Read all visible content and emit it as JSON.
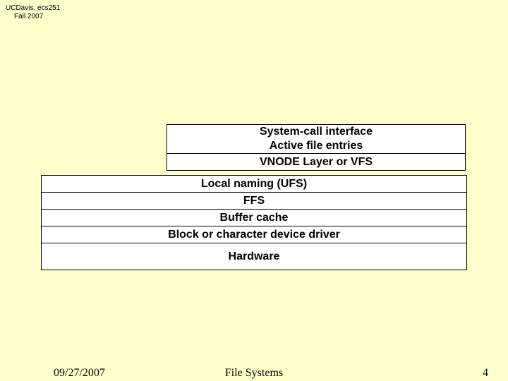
{
  "header": {
    "line1": "UCDavis, ecs251",
    "line2": "Fall 2007"
  },
  "layers": {
    "syscall_line1": "System-call interface",
    "syscall_line2": "Active file entries",
    "vnode": "VNODE Layer or VFS",
    "local_naming": "Local naming (UFS)",
    "ffs": "FFS",
    "buffer_cache": "Buffer cache",
    "device_driver": "Block or character device driver",
    "hardware": "Hardware"
  },
  "footer": {
    "date": "09/27/2007",
    "title": "File Systems",
    "page": "4"
  }
}
